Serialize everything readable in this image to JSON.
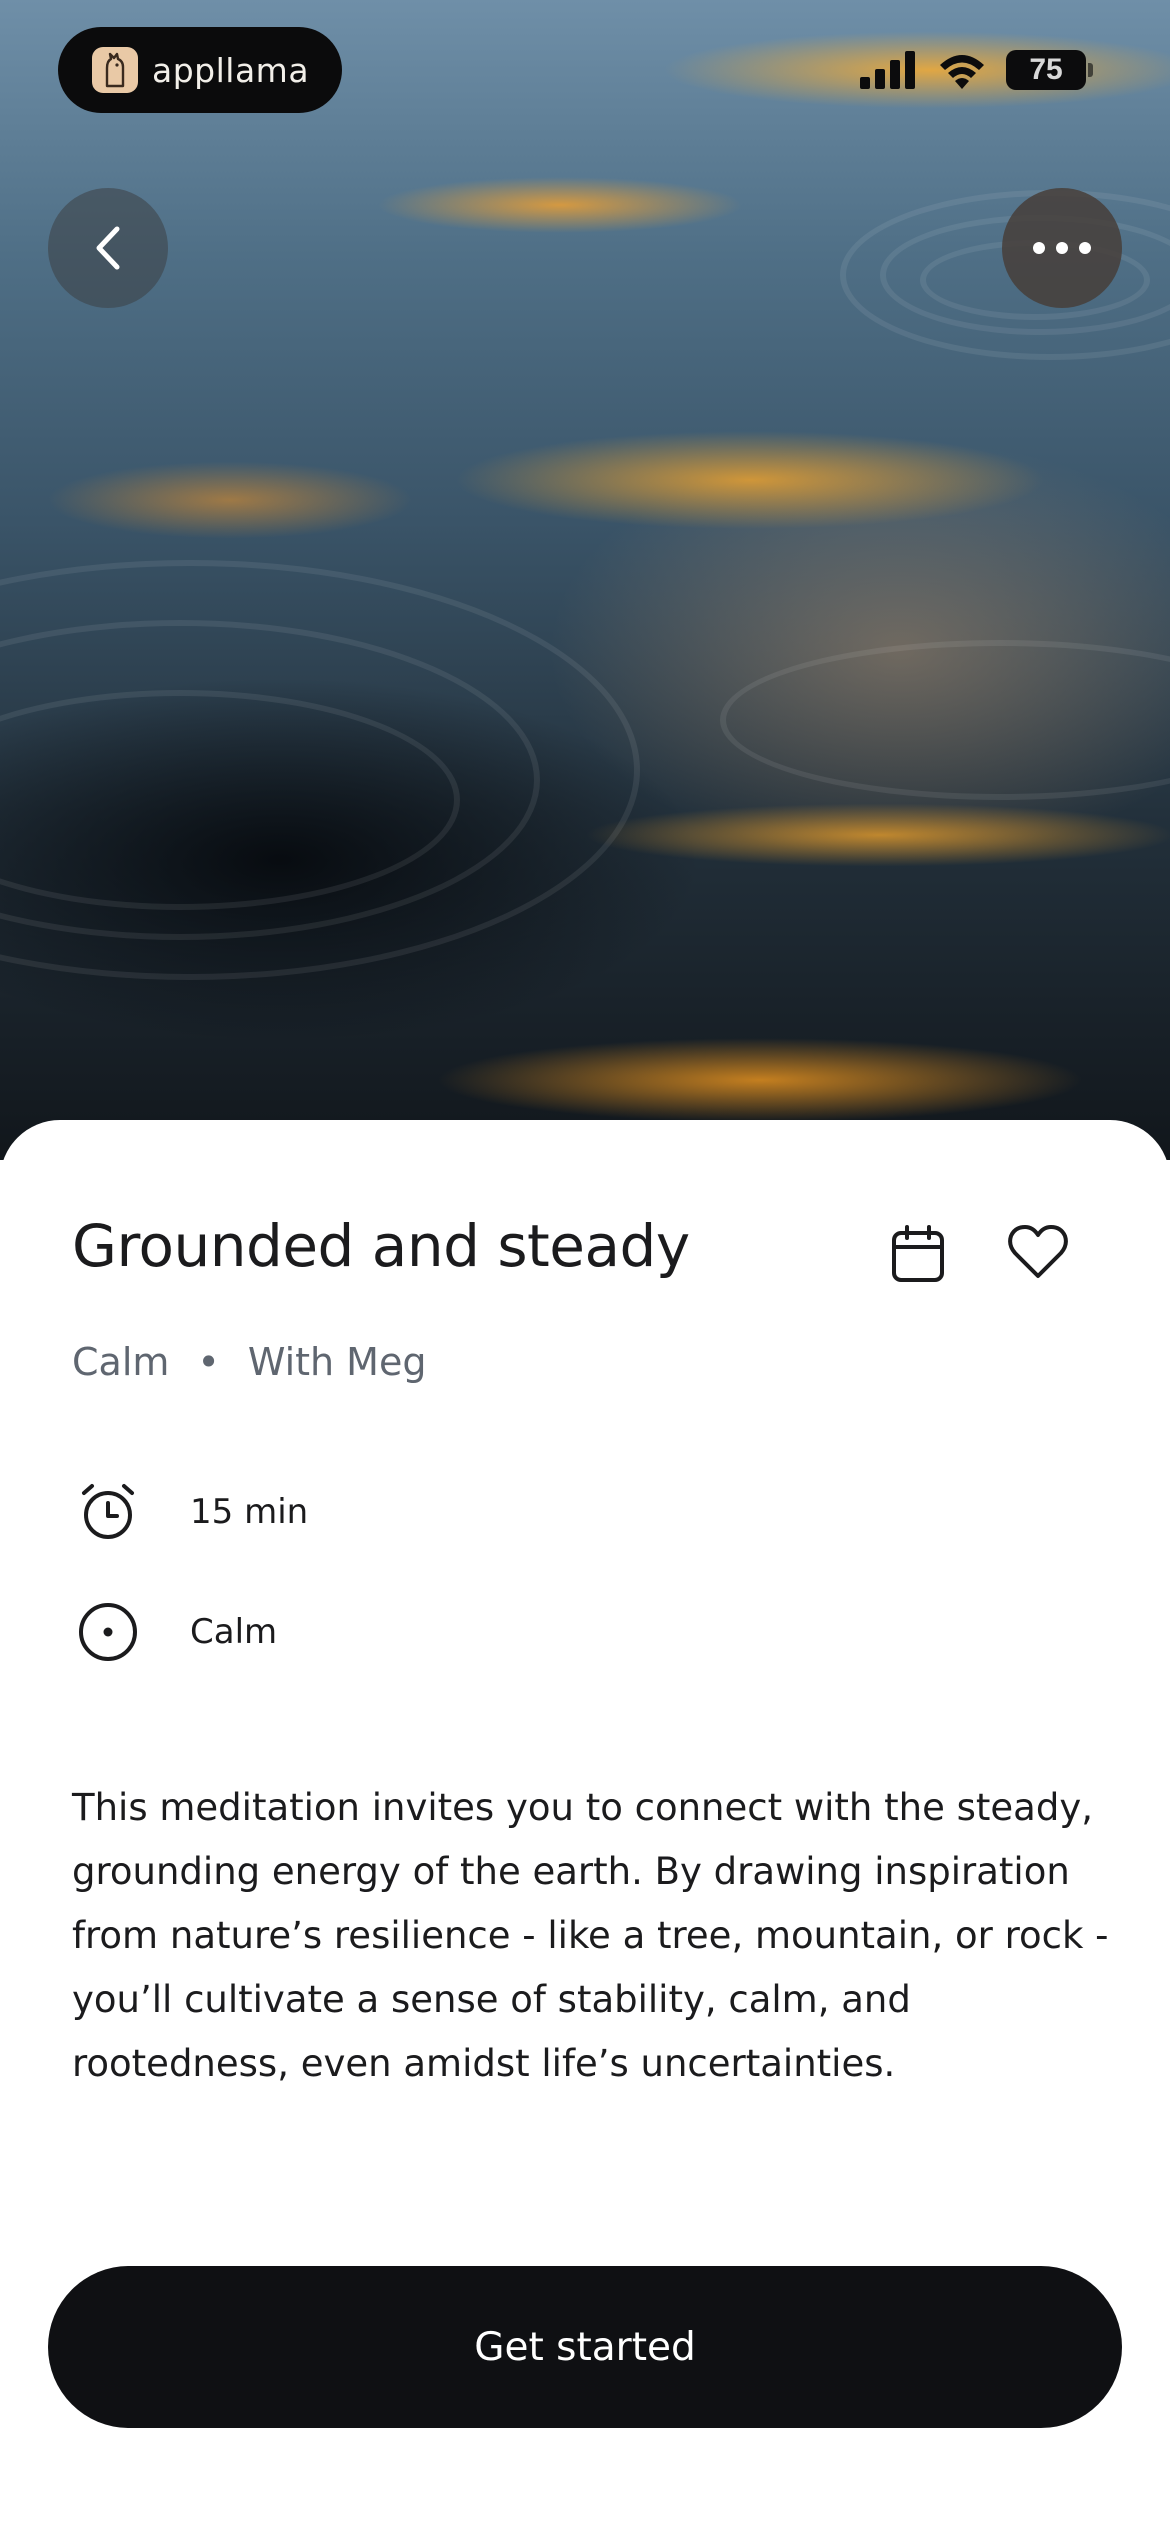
{
  "status_bar": {
    "brand_name": "appllama",
    "battery_level": "75"
  },
  "header": {
    "back_icon": "chevron-left-icon",
    "more_icon": "ellipsis-icon"
  },
  "session": {
    "title": "Grounded and steady",
    "category": "Calm",
    "separator": "•",
    "instructor": "With Meg",
    "duration": "15 min",
    "focus": "Calm",
    "description": "This meditation invites you to connect with the steady, grounding energy of the earth. By drawing inspiration from nature’s resilience - like a tree, mountain, or rock - you’ll cultivate a sense of stability, calm, and rootedness, even amidst life’s uncertainties."
  },
  "actions": {
    "primary_label": "Get started",
    "calendar_icon": "calendar-icon",
    "favorite_icon": "heart-outline-icon"
  },
  "colors": {
    "primary_button": "#0f1013",
    "meta_text": "#5f6670",
    "body_text": "#1b1b1d"
  }
}
